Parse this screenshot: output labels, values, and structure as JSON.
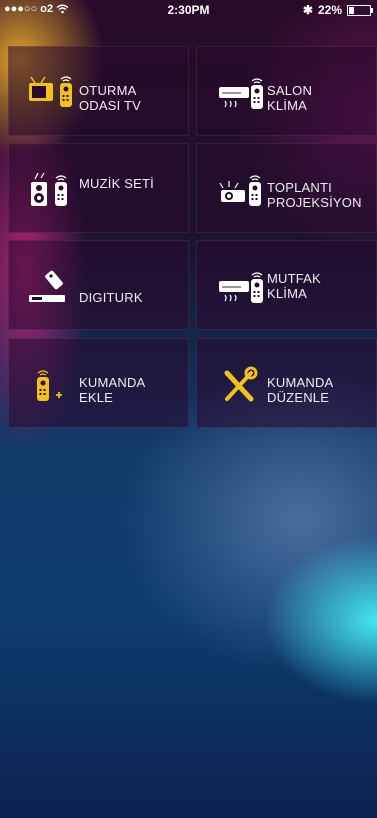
{
  "status_bar": {
    "carrier": "o2",
    "time": "2:30PM",
    "battery": "22%"
  },
  "tiles": [
    {
      "id": "oturma-odasi-tv",
      "line1": "OTURMA",
      "line2": "ODASI TV",
      "icon": "tv-remote-icon"
    },
    {
      "id": "salon-klima",
      "line1": "SALON",
      "line2": "KLİMA",
      "icon": "air-conditioner-remote-icon"
    },
    {
      "id": "muzik-seti",
      "line1": "MUZİK SETİ",
      "line2": "",
      "icon": "speaker-remote-icon"
    },
    {
      "id": "toplanti-projeksiyon",
      "line1": "TOPLANTI",
      "line2": "PROJEKSİYON",
      "icon": "projector-remote-icon"
    },
    {
      "id": "digiturk",
      "line1": "DIGITURK",
      "line2": "",
      "icon": "satellite-receiver-remote-icon"
    },
    {
      "id": "mutfak-klima",
      "line1": "MUTFAK",
      "line2": "KLİMA",
      "icon": "air-conditioner-remote-icon"
    },
    {
      "id": "kumanda-ekle",
      "line1": "KUMANDA",
      "line2": "EKLE",
      "icon": "add-remote-icon"
    },
    {
      "id": "kumanda-duzenle",
      "line1": "KUMANDA",
      "line2": "DÜZENLE",
      "icon": "wrench-screwdriver-icon"
    }
  ],
  "colors": {
    "accent": "#f2c21a"
  }
}
